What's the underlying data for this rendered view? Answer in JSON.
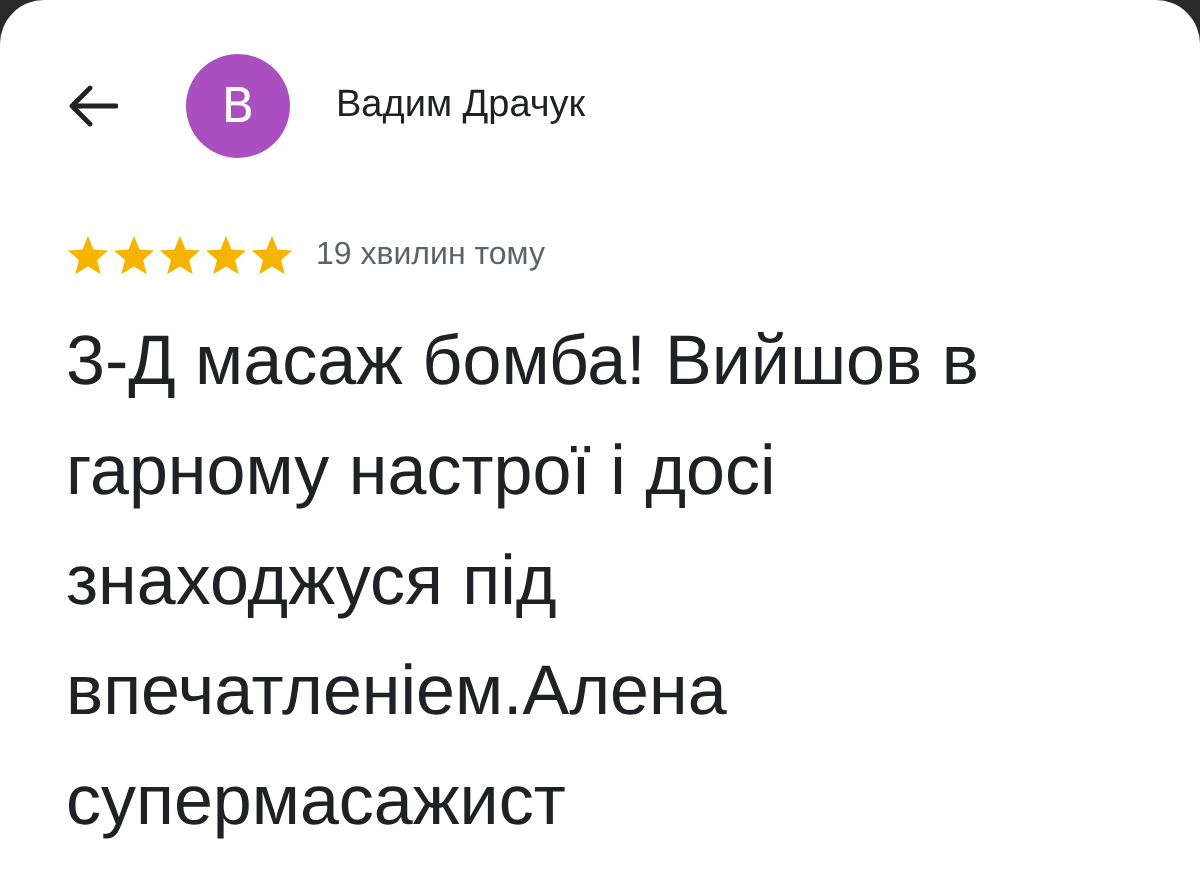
{
  "review": {
    "author": "Вадим Драчук",
    "avatar_letter": "В",
    "stars": 5,
    "time": "19 хвилин тому",
    "text": "3-Д масаж бомба! Вийшов в гарному настрої і досі знаходжуся під впечатленіем.Алена супермасажист"
  }
}
